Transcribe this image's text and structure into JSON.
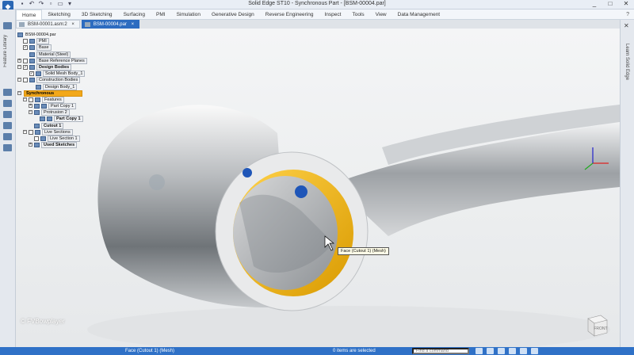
{
  "app": {
    "title": "Solid Edge ST10 - Synchronous Part - [BSM-00004.par]",
    "logo_icon": "solid-edge-logo-icon",
    "window_controls": [
      "_",
      "□",
      "✕"
    ]
  },
  "ribbon": {
    "tabs": [
      "Home",
      "Sketching",
      "3D Sketching",
      "Surfacing",
      "PMI",
      "Simulation",
      "Generative Design",
      "Reverse Engineering",
      "Inspect",
      "Tools",
      "View",
      "Data Management"
    ],
    "active": "Home",
    "help": "?"
  },
  "left_strip": {
    "label": "Feature Library"
  },
  "right_strip": {
    "label": "Learn Solid Edge"
  },
  "doc_tabs": [
    {
      "label": "BSM-00001.asm:2",
      "active": false
    },
    {
      "label": "BSM-00004.par",
      "active": true
    }
  ],
  "tree": {
    "root": "BSM-00004.par",
    "items": [
      {
        "label": "PMI",
        "style": "boxed"
      },
      {
        "label": "Base",
        "style": "boxed"
      },
      {
        "label": "Material (Steel)",
        "style": "boxed"
      },
      {
        "label": "Base Reference Planes",
        "style": "boxed"
      },
      {
        "label": "Design Bodies",
        "style": "boxed"
      },
      {
        "label": "Solid Mesh Body_1",
        "style": "boxed"
      },
      {
        "label": "Construction Bodies",
        "style": "boxed"
      },
      {
        "label": "Design Body_1",
        "style": "boxed"
      },
      {
        "label": "Synchronous",
        "style": "sync"
      },
      {
        "label": "Features",
        "style": "boxed"
      },
      {
        "label": "Part Copy 1",
        "style": "boxed"
      },
      {
        "label": "Protrusion 2",
        "style": "boxed"
      },
      {
        "label": "Part Copy 1",
        "style": "boxed-bold"
      },
      {
        "label": "Cutout 1",
        "style": "boxed-bold"
      },
      {
        "label": "Live Sections",
        "style": "boxed"
      },
      {
        "label": "Live Section 1",
        "style": "boxed"
      },
      {
        "label": "Used Sketches",
        "style": "boxed-bold"
      }
    ]
  },
  "viewport": {
    "tooltip": "Face (Cutout 1) (Mesh)",
    "watermark": "© FVBowplayer",
    "viewcube_label": "FRONT",
    "axis_colors": {
      "x": "#d22",
      "y": "#2a2",
      "z": "#22c"
    }
  },
  "status": {
    "message": "Face (Cutout 1) (Mesh)",
    "selection": "0 items are selected",
    "find_placeholder": "Find a command"
  }
}
